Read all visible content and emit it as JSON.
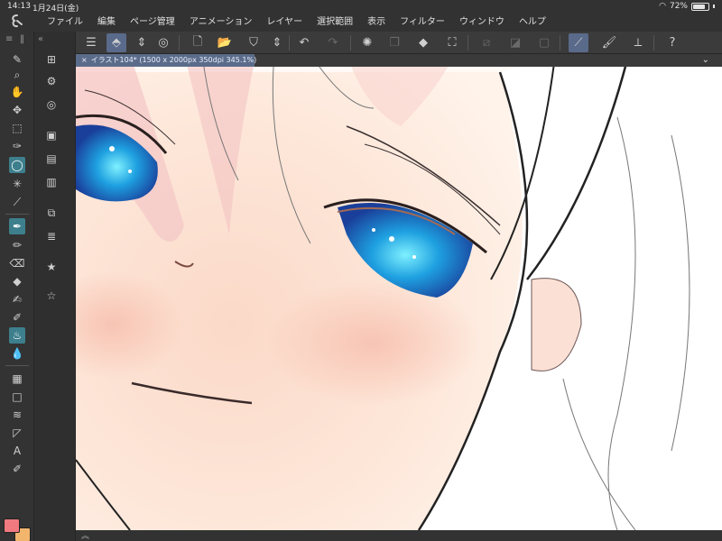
{
  "status": {
    "time": "14:13",
    "date": "1月24日(金)",
    "battery": "72%"
  },
  "app": {
    "logo_icon": "clip-studio-logo-icon"
  },
  "menu": [
    "ファイル",
    "編集",
    "ページ管理",
    "アニメーション",
    "レイヤー",
    "選択範囲",
    "表示",
    "フィルター",
    "ウィンドウ",
    "ヘルプ"
  ],
  "document": {
    "tab_title": "イラスト104* (1500 x 2000px 350dpi 345.1%)",
    "close_glyph": "×"
  },
  "panels": {
    "tool_head_left": "≡",
    "tool_head_right": "‖",
    "sub_head": "«"
  },
  "colors": {
    "main": "#f07a7f",
    "sub": "#f2b56e",
    "accent": "#3d7f8d",
    "tab": "#5b6c8a"
  },
  "bottom": {
    "expand_glyph": "︽"
  }
}
